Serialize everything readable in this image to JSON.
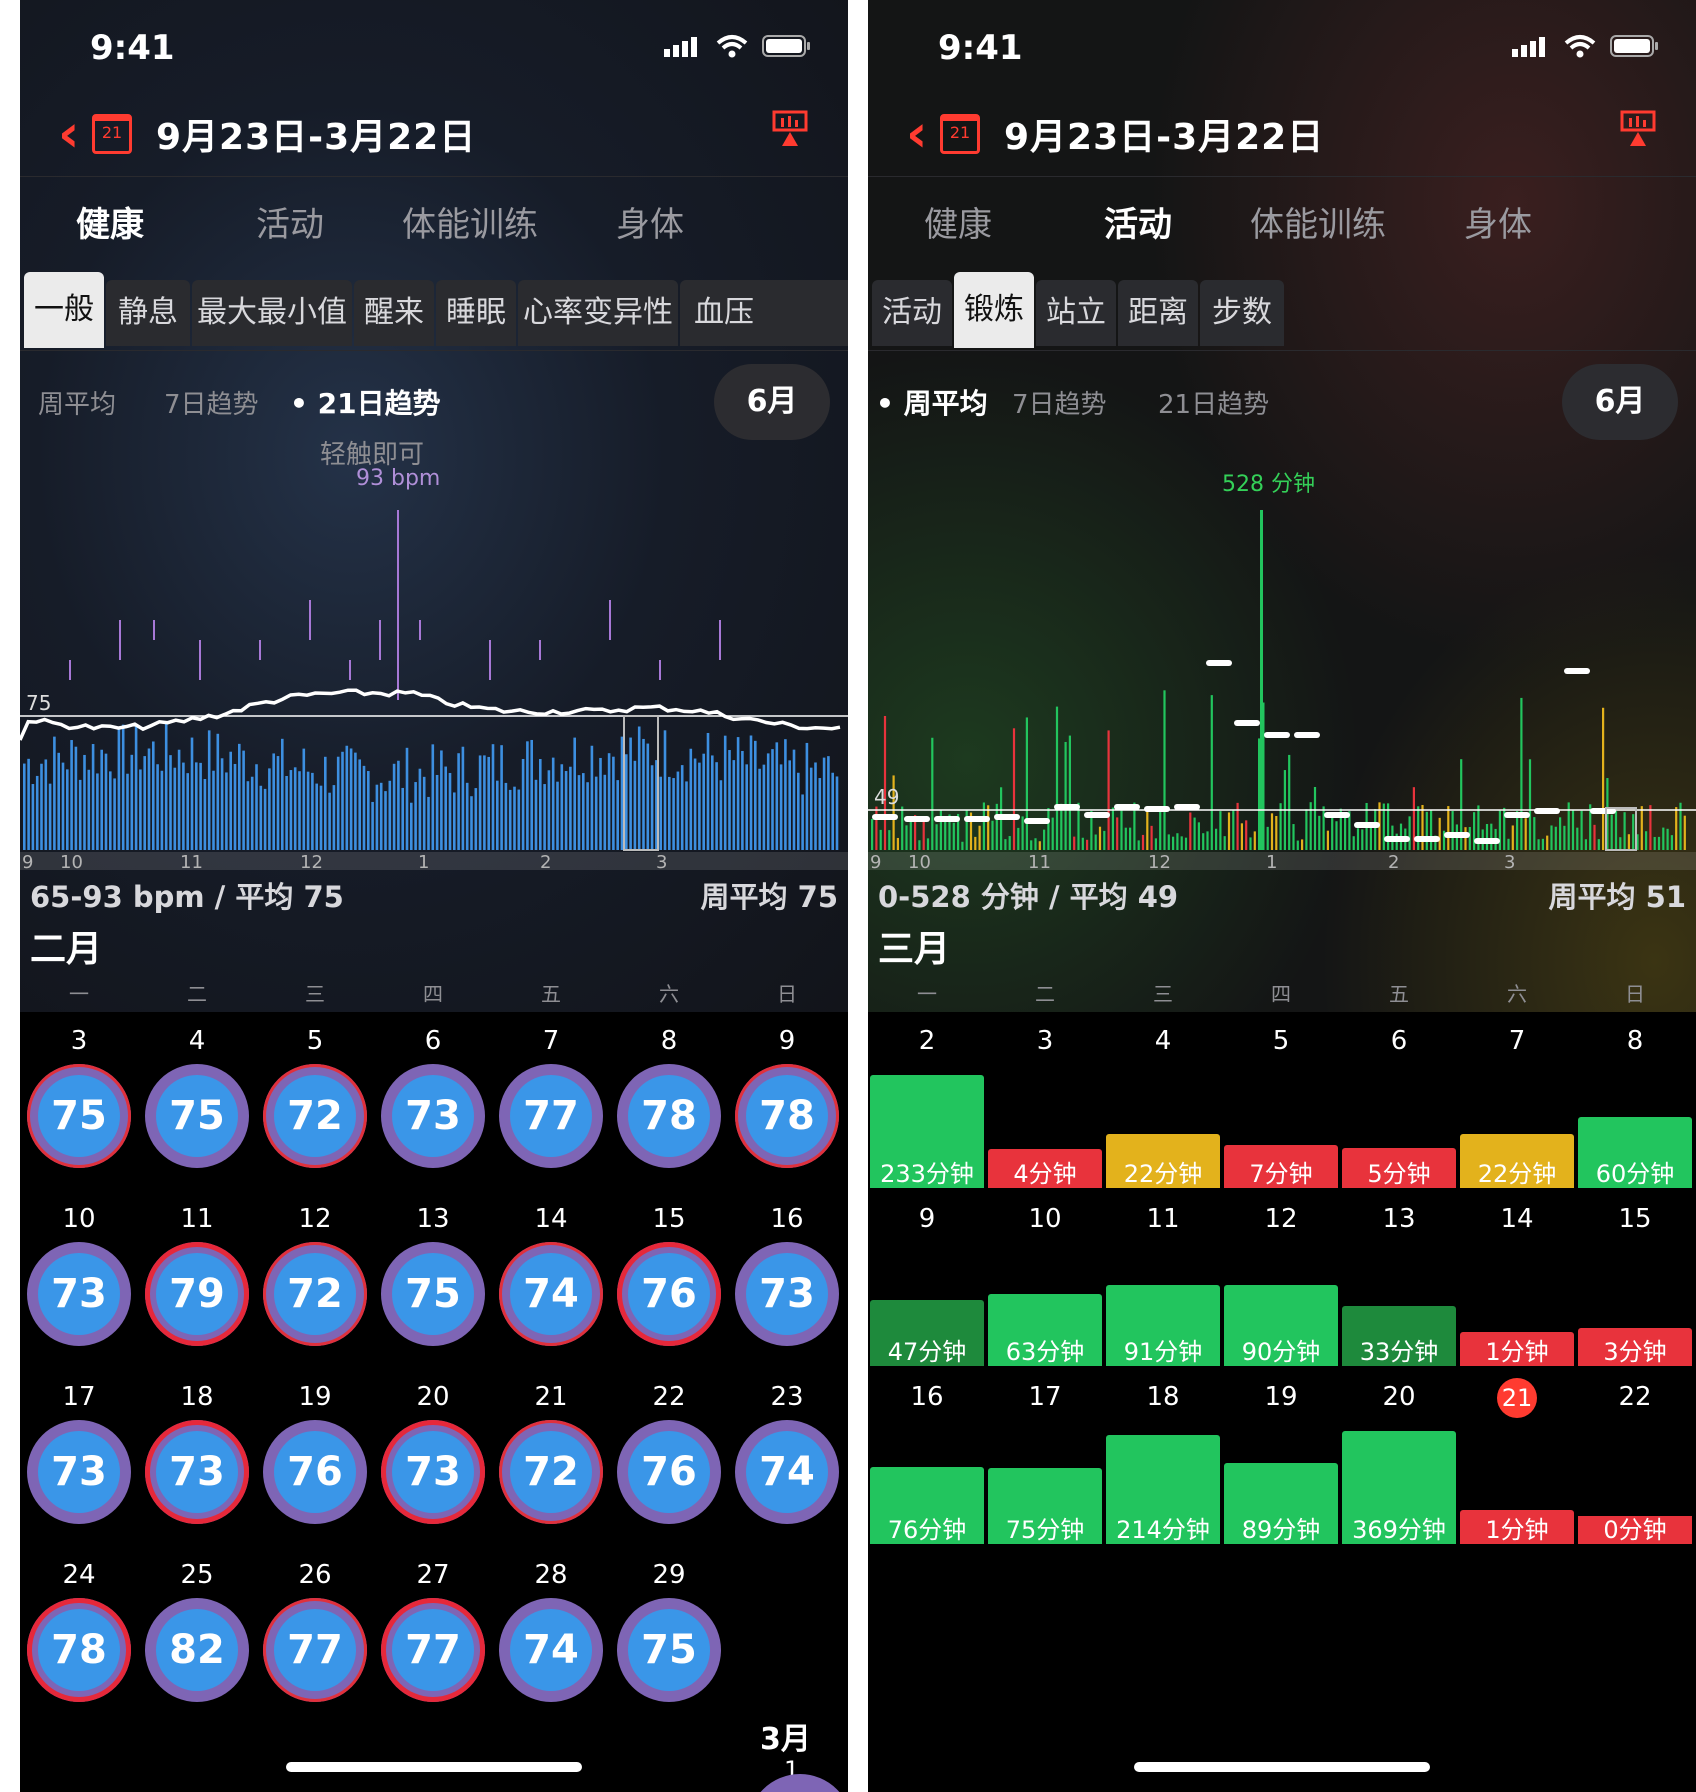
{
  "colors": {
    "red": "#ff3b30",
    "blue": "#3a96e8",
    "purple": "#7e65b5",
    "green": "#22c55e",
    "dark_green": "#1e8a3c",
    "yellow": "#e3b21c"
  },
  "status": {
    "time": "9:41",
    "icons": [
      "signal-icon",
      "wifi-icon",
      "battery-icon"
    ]
  },
  "left": {
    "nav": {
      "title": "9月23日-3月22日",
      "cal_icon_text": "21"
    },
    "segments": [
      "健康",
      "活动",
      "体能训练",
      "身体"
    ],
    "selected_segment": 0,
    "subtabs": [
      "一般",
      "静息",
      "最大最小值",
      "醒来",
      "睡眠",
      "心率变异性",
      "血压"
    ],
    "selected_subtab": 0,
    "trends": [
      "周平均",
      "7日趋势",
      "• 21日趋势"
    ],
    "selected_trend": 2,
    "month_button": "6月",
    "hint": "轻触即可",
    "peak_label": "93 bpm",
    "avg_marker": "75",
    "x_labels": [
      "9",
      "10",
      "11",
      "12",
      "1",
      "2",
      "3"
    ],
    "stats_left": "65-93 bpm / 平均 75",
    "stats_right": "周平均 75",
    "month_name": "二月",
    "weekdays": [
      "一",
      "二",
      "三",
      "四",
      "五",
      "六",
      "日"
    ],
    "days": [
      {
        "day": "3",
        "value": "75",
        "ring": "purple-red"
      },
      {
        "day": "4",
        "value": "75",
        "ring": "purple"
      },
      {
        "day": "5",
        "value": "72",
        "ring": "blue-red"
      },
      {
        "day": "6",
        "value": "73",
        "ring": "purple"
      },
      {
        "day": "7",
        "value": "77",
        "ring": "purple"
      },
      {
        "day": "8",
        "value": "78",
        "ring": "purple"
      },
      {
        "day": "9",
        "value": "78",
        "ring": "purple-red"
      },
      {
        "day": "10",
        "value": "73",
        "ring": "purple"
      },
      {
        "day": "11",
        "value": "79",
        "ring": "red"
      },
      {
        "day": "12",
        "value": "72",
        "ring": "purple-red"
      },
      {
        "day": "13",
        "value": "75",
        "ring": "purple"
      },
      {
        "day": "14",
        "value": "74",
        "ring": "purple-red"
      },
      {
        "day": "15",
        "value": "76",
        "ring": "red"
      },
      {
        "day": "16",
        "value": "73",
        "ring": "purple"
      },
      {
        "day": "17",
        "value": "73",
        "ring": "purple"
      },
      {
        "day": "18",
        "value": "73",
        "ring": "red"
      },
      {
        "day": "19",
        "value": "76",
        "ring": "purple"
      },
      {
        "day": "20",
        "value": "73",
        "ring": "red"
      },
      {
        "day": "21",
        "value": "72",
        "ring": "purple-red"
      },
      {
        "day": "22",
        "value": "76",
        "ring": "purple"
      },
      {
        "day": "23",
        "value": "74",
        "ring": "purple"
      },
      {
        "day": "24",
        "value": "78",
        "ring": "red"
      },
      {
        "day": "25",
        "value": "82",
        "ring": "purple"
      },
      {
        "day": "26",
        "value": "77",
        "ring": "purple-red"
      },
      {
        "day": "27",
        "value": "77",
        "ring": "red"
      },
      {
        "day": "28",
        "value": "74",
        "ring": "purple"
      },
      {
        "day": "29",
        "value": "75",
        "ring": "purple"
      }
    ],
    "next_month": "3月",
    "next_day": "1"
  },
  "right": {
    "nav": {
      "title": "9月23日-3月22日",
      "cal_icon_text": "21"
    },
    "segments": [
      "健康",
      "活动",
      "体能训练",
      "身体"
    ],
    "selected_segment": 1,
    "subtabs": [
      "活动",
      "锻炼",
      "站立",
      "距离",
      "步数"
    ],
    "selected_subtab": 1,
    "trends": [
      "• 周平均",
      "7日趋势",
      "21日趋势"
    ],
    "selected_trend": 0,
    "month_button": "6月",
    "peak_label": "528 分钟",
    "avg_marker": "49",
    "x_labels": [
      "9",
      "10",
      "11",
      "12",
      "1",
      "2",
      "3"
    ],
    "stats_left": "0-528 分钟 / 平均 49",
    "stats_right": "周平均 51",
    "month_name": "三月",
    "weekdays": [
      "一",
      "二",
      "三",
      "四",
      "五",
      "六",
      "日"
    ],
    "days": [
      {
        "day": "2",
        "label": "233分钟",
        "minutes": 233,
        "color": "green"
      },
      {
        "day": "3",
        "label": "4分钟",
        "minutes": 4,
        "color": "red"
      },
      {
        "day": "4",
        "label": "22分钟",
        "minutes": 22,
        "color": "yellow"
      },
      {
        "day": "5",
        "label": "7分钟",
        "minutes": 7,
        "color": "red"
      },
      {
        "day": "6",
        "label": "5分钟",
        "minutes": 5,
        "color": "red"
      },
      {
        "day": "7",
        "label": "22分钟",
        "minutes": 22,
        "color": "yellow"
      },
      {
        "day": "8",
        "label": "60分钟",
        "minutes": 60,
        "color": "green"
      },
      {
        "day": "9",
        "label": "47分钟",
        "minutes": 47,
        "color": "dark_green"
      },
      {
        "day": "10",
        "label": "63分钟",
        "minutes": 63,
        "color": "green"
      },
      {
        "day": "11",
        "label": "91分钟",
        "minutes": 91,
        "color": "green"
      },
      {
        "day": "12",
        "label": "90分钟",
        "minutes": 90,
        "color": "green"
      },
      {
        "day": "13",
        "label": "33分钟",
        "minutes": 33,
        "color": "dark_green"
      },
      {
        "day": "14",
        "label": "1分钟",
        "minutes": 1,
        "color": "red"
      },
      {
        "day": "15",
        "label": "3分钟",
        "minutes": 3,
        "color": "red"
      },
      {
        "day": "16",
        "label": "76分钟",
        "minutes": 76,
        "color": "green"
      },
      {
        "day": "17",
        "label": "75分钟",
        "minutes": 75,
        "color": "green"
      },
      {
        "day": "18",
        "label": "214分钟",
        "minutes": 214,
        "color": "green"
      },
      {
        "day": "19",
        "label": "89分钟",
        "minutes": 89,
        "color": "green"
      },
      {
        "day": "20",
        "label": "369分钟",
        "minutes": 369,
        "color": "green"
      },
      {
        "day": "21",
        "label": "1分钟",
        "minutes": 1,
        "color": "red",
        "today": true
      },
      {
        "day": "22",
        "label": "0分钟",
        "minutes": 0,
        "color": "red"
      }
    ]
  }
}
